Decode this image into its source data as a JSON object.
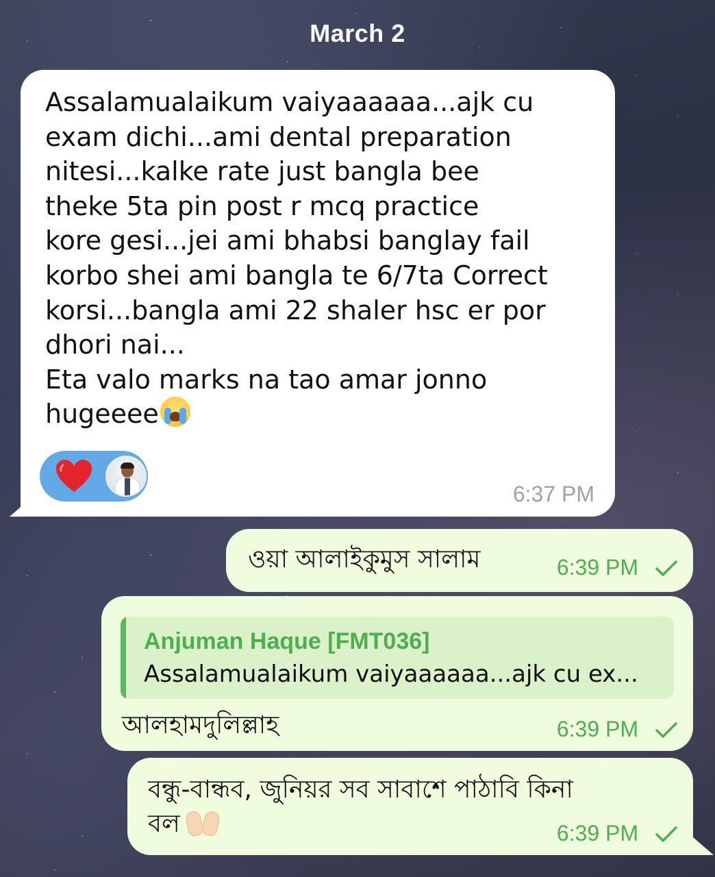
{
  "date_header": "March 2",
  "incoming_message": {
    "text": "Assalamualaikum vaiyaaaaaa...ajk cu\nexam dichi...ami dental preparation\nnitesi...kalke rate just bangla bee\ntheke 5ta pin post r mcq practice\nkore gesi...jei ami bhabsi banglay fail\nkorbo shei ami bangla te 6/7ta Correct\nkorsi...bangla ami 22 shaler hsc er por\ndhori nai...\nEta valo marks na tao amar jonno\nhugeeee",
    "emoji": "loudly-crying-face",
    "reaction": "heart",
    "time": "6:37 PM"
  },
  "outgoing_messages": [
    {
      "text": "ওয়া আলাইকুমুস সালাম",
      "time": "6:39 PM",
      "status": "sent-check"
    },
    {
      "reply_to": {
        "name": "Anjuman Haque [FMT036]",
        "snippet": "Assalamualaikum vaiyaaaaaa...ajk cu ex..."
      },
      "text": "আলহামদুলিল্লাহ",
      "time": "6:39 PM",
      "status": "sent-check"
    },
    {
      "text_line1": "বন্ধু-বান্ধব, জুনিয়র সব সাবাশে পাঠাবি কিনা",
      "text_line2": "বল",
      "emoji": "palms-up-together",
      "time": "6:39 PM",
      "status": "sent-check"
    }
  ],
  "colors": {
    "incoming_bubble": "#ffffff",
    "outgoing_bubble": "#effdde",
    "reply_accent": "#4fae4e",
    "reaction_pill": "#62a9e6",
    "heart": "#e3242b",
    "time_incoming": "#9aa3ab",
    "time_outgoing": "#4fae4e"
  }
}
